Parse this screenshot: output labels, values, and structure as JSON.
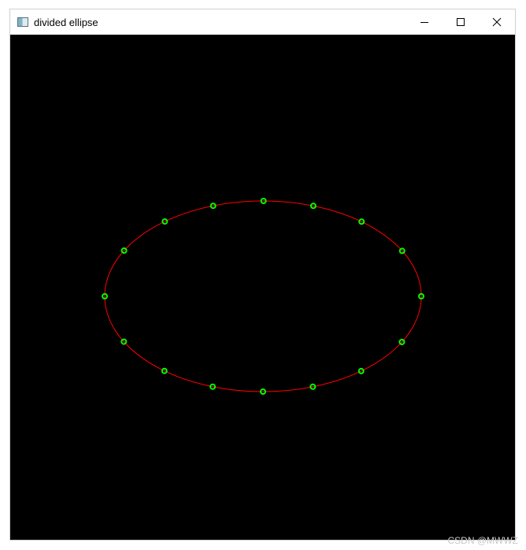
{
  "window": {
    "title": "divided ellipse",
    "icon": "app-window-icon",
    "controls": [
      {
        "name": "minimize-button",
        "icon": "minimize-icon"
      },
      {
        "name": "maximize-button",
        "icon": "maximize-icon"
      },
      {
        "name": "close-button",
        "icon": "close-icon"
      }
    ]
  },
  "canvas": {
    "background": "#000000",
    "ellipse_color": "#ff0000",
    "point_color": "#00ff00",
    "division_points": 16
  },
  "watermark": "CSDN @MWWZ"
}
